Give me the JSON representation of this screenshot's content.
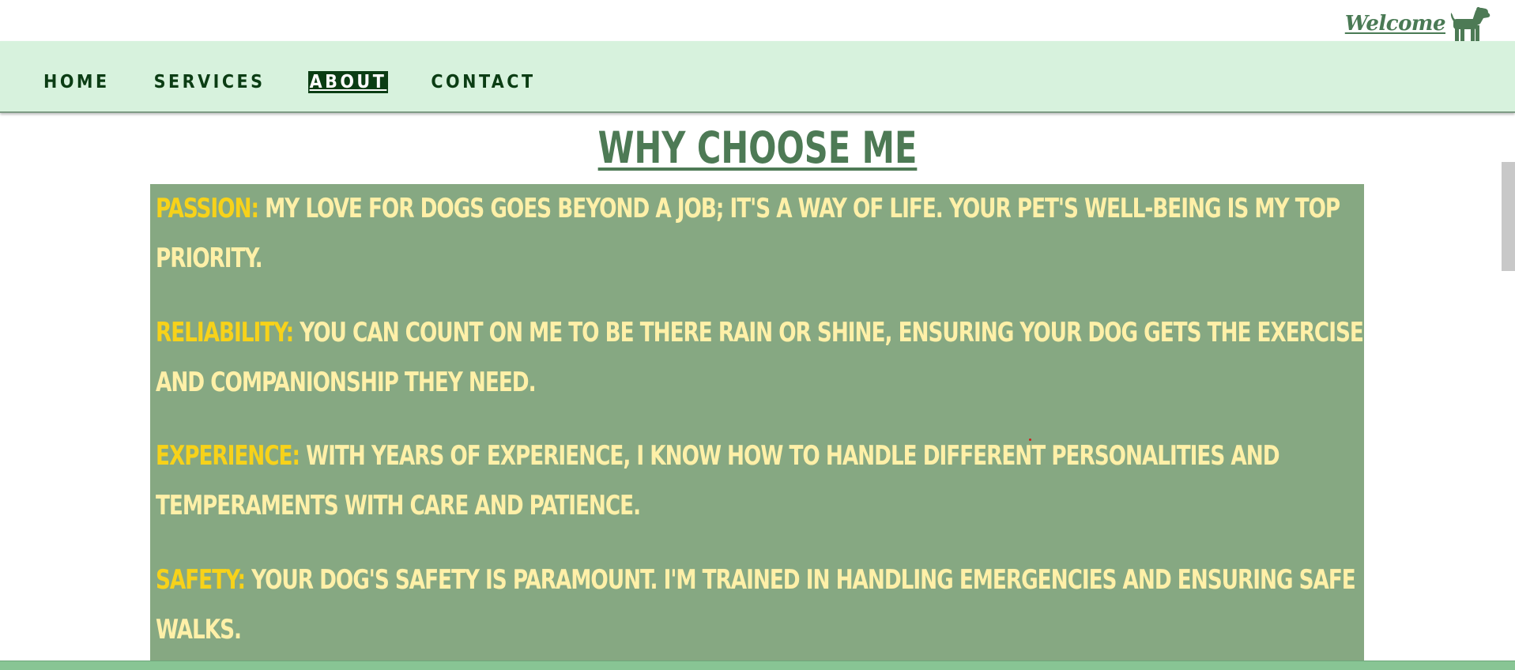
{
  "header": {
    "welcome_text": "Welcome",
    "logo_icon": "dog-icon"
  },
  "nav": {
    "items": [
      {
        "label": "HOME",
        "active": false
      },
      {
        "label": "SERVICES",
        "active": false
      },
      {
        "label": "ABOUT",
        "active": true
      },
      {
        "label": "CONTACT",
        "active": false
      }
    ]
  },
  "section": {
    "title": "WHY CHOOSE ME",
    "reasons": [
      {
        "label": "PASSION:",
        "text": "MY LOVE FOR DOGS GOES BEYOND A JOB; IT'S A WAY OF LIFE. YOUR PET'S WELL-BEING IS MY TOP PRIORITY."
      },
      {
        "label": "RELIABILITY:",
        "text": "YOU CAN COUNT ON ME TO BE THERE RAIN OR SHINE, ENSURING YOUR DOG GETS THE EXERCISE AND COMPANIONSHIP THEY NEED."
      },
      {
        "label": "EXPERIENCE:",
        "text": "WITH YEARS OF EXPERIENCE, I KNOW HOW TO HANDLE DIFFERENT PERSONALITIES AND TEMPERAMENTS WITH CARE AND PATIENCE."
      },
      {
        "label": "SAFETY:",
        "text": "YOUR DOG'S SAFETY IS PARAMOUNT. I'M TRAINED IN HANDLING EMERGENCIES AND ENSURING SAFE WALKS."
      }
    ]
  },
  "colors": {
    "nav_bg": "#d7f2dd",
    "nav_text": "#0b3d14",
    "title": "#4d7a55",
    "box_bg": "#86a882",
    "label": "#f7d21a",
    "body_text": "#fff0a8",
    "footer": "#88c594"
  }
}
